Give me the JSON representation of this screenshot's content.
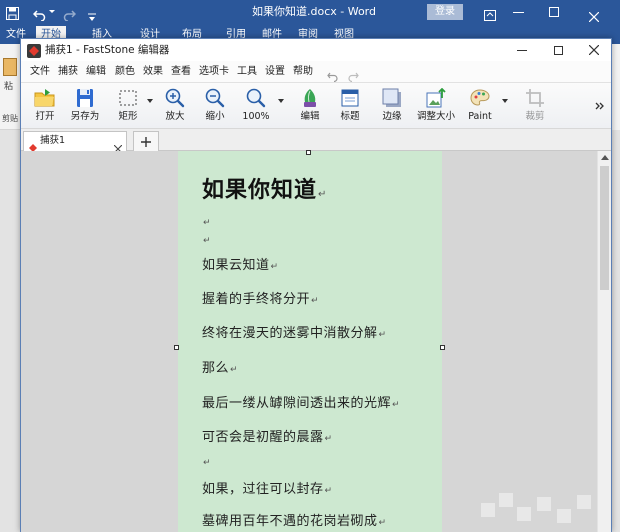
{
  "word": {
    "title": "如果你知道.docx - Word",
    "login_label": "登录",
    "tabs": [
      "文件",
      "开始",
      "插入",
      "设计",
      "布局",
      "引用",
      "邮件",
      "审阅",
      "视图"
    ],
    "active_tab": "开始",
    "ribbon_left": {
      "paste_label": "粘",
      "clipboard_label": "剪贴"
    },
    "quick_access_icons": [
      "save-icon",
      "undo-icon",
      "redo-icon",
      "customize-icon"
    ],
    "window_icons": [
      "ribbon-display-icon",
      "minimize-icon",
      "maximize-icon",
      "close-icon"
    ]
  },
  "faststone": {
    "title": "捕获1 - FastStone 编辑器",
    "menu": [
      "文件",
      "捕获",
      "编辑",
      "颜色",
      "效果",
      "查看",
      "选项卡",
      "工具",
      "设置",
      "帮助"
    ],
    "toolbar": [
      {
        "label": "打开",
        "icon": "open-folder-icon"
      },
      {
        "label": "另存为",
        "icon": "save-as-icon"
      },
      {
        "label": "矩形",
        "icon": "rectangle-select-icon"
      },
      {
        "label": "放大",
        "icon": "zoom-in-icon"
      },
      {
        "label": "缩小",
        "icon": "zoom-out-icon"
      },
      {
        "label": "100%",
        "icon": "zoom-actual-icon"
      },
      {
        "label": "编辑",
        "icon": "edit-icon"
      },
      {
        "label": "标题",
        "icon": "caption-icon"
      },
      {
        "label": "边缘",
        "icon": "edge-icon"
      },
      {
        "label": "调整大小",
        "icon": "resize-icon"
      },
      {
        "label": "Paint",
        "icon": "paint-icon"
      },
      {
        "label": "裁剪",
        "icon": "crop-icon",
        "disabled": true
      }
    ],
    "tab_label": "捕获1",
    "document": {
      "heading": "如果你知道",
      "paragraph_mark": "↵",
      "lines": [
        "",
        "",
        "如果云知道",
        "握着的手终将分开",
        "终将在漫天的迷雾中消散分解",
        "那么",
        "最后一缕从罅隙间透出来的光辉",
        "可否会是初醒的晨露",
        "",
        "如果，过往可以封存",
        "墓碑用百年不遇的花岗岩砌成"
      ]
    }
  },
  "colors": {
    "word_blue": "#2b579a",
    "page_green": "#cde8d0",
    "canvas_gray": "#d6d6d6",
    "window_border": "#5b7fb5"
  }
}
